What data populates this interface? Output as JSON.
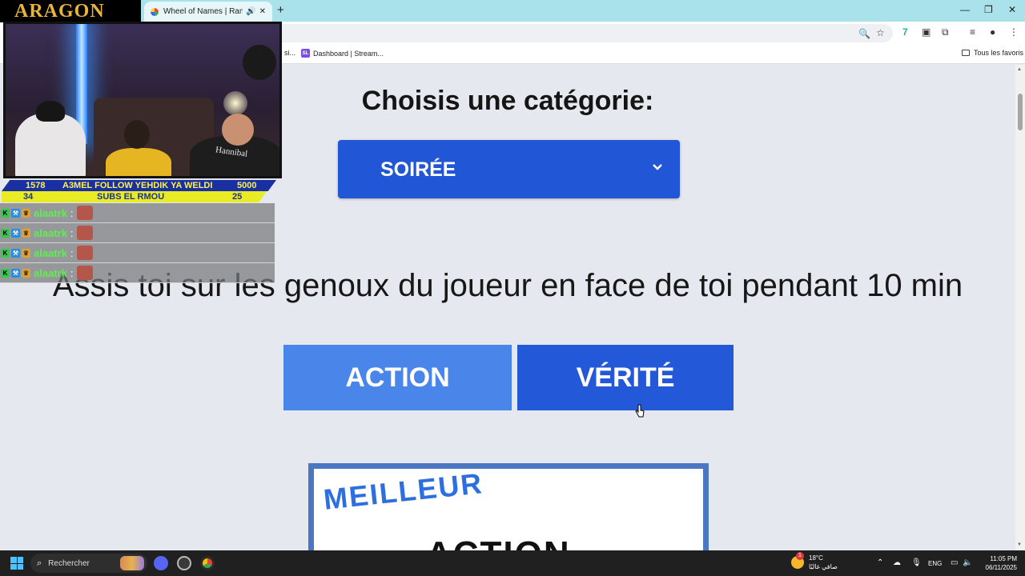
{
  "browser": {
    "tab_title": "Wheel of Names | Random",
    "tab_audio_icon": "speaker-icon",
    "new_tab": "+",
    "bookmarks": [
      {
        "label": "si..."
      },
      {
        "label": "Dashboard | Stream...",
        "badge": "SL"
      }
    ],
    "all_bookmarks": "Tous les favoris"
  },
  "overlay": {
    "logo": "ARAGON",
    "ticker_row1": {
      "left": "1578",
      "center": "A3MEL FOLLOW YEHDIK YA WELDI",
      "right": "5000"
    },
    "ticker_row2": {
      "left": "34",
      "center": "SUBS EL RMOU",
      "right": "25"
    },
    "webcam_shirt_text": "Hannibal",
    "chat": [
      {
        "user": "alaatrk",
        "sep": ":"
      },
      {
        "user": "alaatrk",
        "sep": ":"
      },
      {
        "user": "alaatrk",
        "sep": ":"
      },
      {
        "user": "alaatrk",
        "sep": ":"
      }
    ]
  },
  "page": {
    "heading": "Choisis une catégorie:",
    "category_select": "SOIRÉE",
    "dare_text": "Assis toi sur les genoux du joueur en face de toi pendant 10 min",
    "action_button": "ACTION",
    "verite_button": "VÉRITÉ",
    "card_line1": "MEILLEUR",
    "card_line2": "ACTION"
  },
  "taskbar": {
    "search": "Rechercher",
    "weather_temp": "18°C",
    "weather_desc": "صافي غالبًا",
    "language": "ENG",
    "time": "11:05 PM",
    "date": "06/11/2025",
    "weather_badge": "1"
  },
  "colors": {
    "select_bg": "#2157d6",
    "action_bg": "#4a86ea",
    "verite_bg": "#2359d9",
    "chrome_frame": "#a9e2ea"
  }
}
